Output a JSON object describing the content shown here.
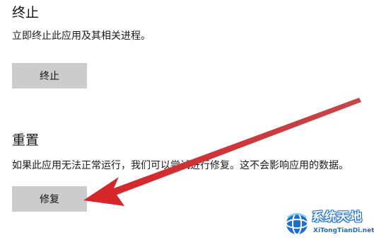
{
  "terminate": {
    "heading": "终止",
    "description": "立即终止此应用及其相关进程。",
    "button_label": "终止"
  },
  "reset": {
    "heading": "重置",
    "description": "如果此应用无法正常运行，我们可以尝试进行修复。这不会影响应用的数据。",
    "button_label": "修复"
  },
  "annotation": {
    "arrow_color": "#d6262a"
  },
  "watermark": {
    "title": "系统天地",
    "subtitle": "XiTongTianDi.net",
    "brand_color": "#1b6fd0"
  }
}
